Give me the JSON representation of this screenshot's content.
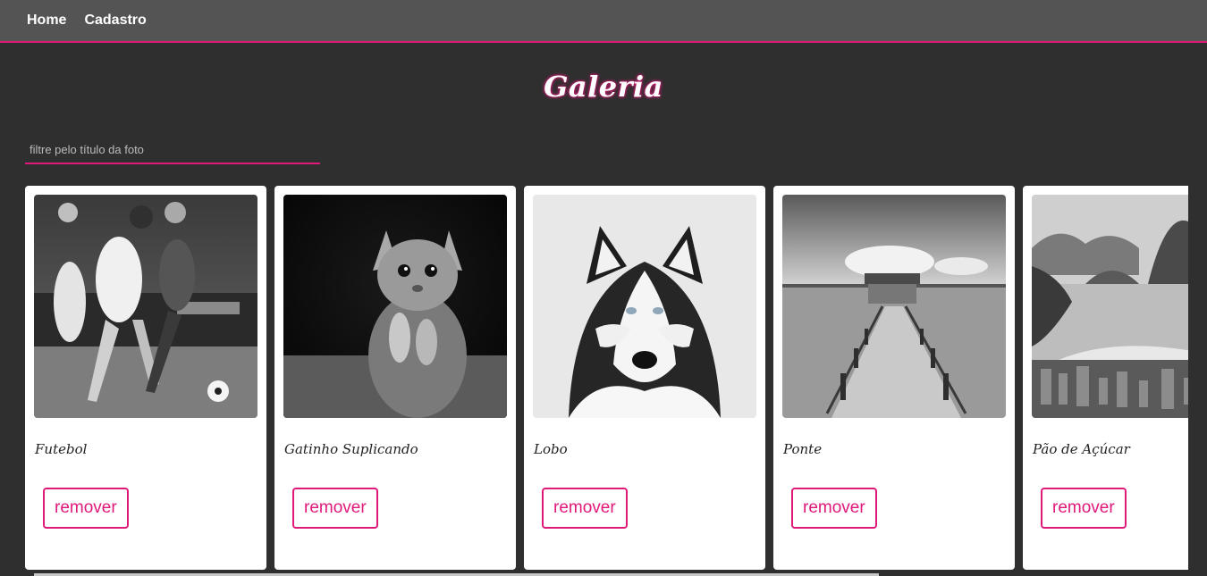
{
  "nav": {
    "items": [
      {
        "label": "Home"
      },
      {
        "label": "Cadastro"
      }
    ]
  },
  "page": {
    "title": "Galeria"
  },
  "filter": {
    "placeholder": "filtre pelo título da foto",
    "value": ""
  },
  "colors": {
    "accent": "#e0187a",
    "navbar": "#545454",
    "background": "#2f2f2f",
    "card": "#ffffff"
  },
  "photos": [
    {
      "title": "Futebol",
      "image": "soccer-players-photo",
      "remove_label": "remover"
    },
    {
      "title": "Gatinho Suplicando",
      "image": "kitten-begging-photo",
      "remove_label": "remover"
    },
    {
      "title": "Lobo",
      "image": "husky-wolf-photo",
      "remove_label": "remover"
    },
    {
      "title": "Ponte",
      "image": "pier-bridge-photo",
      "remove_label": "remover"
    },
    {
      "title": "Pão de Açúcar",
      "image": "sugarloaf-mountain-photo",
      "remove_label": "remover"
    }
  ]
}
